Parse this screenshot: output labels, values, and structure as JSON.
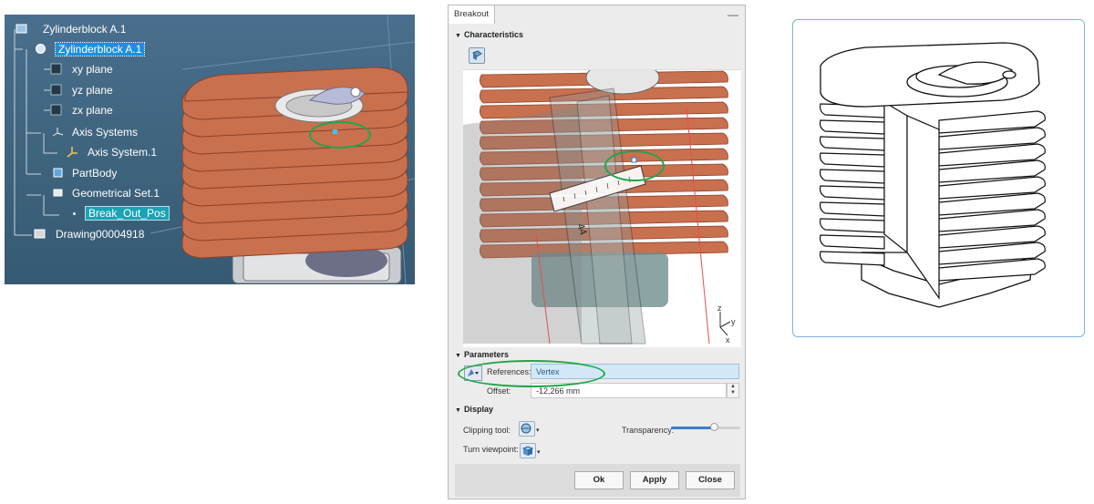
{
  "tree": {
    "root": "Zylinderblock A.1",
    "part": "Zylinderblock A.1",
    "nodes": {
      "xy": "xy plane",
      "yz": "yz plane",
      "zx": "zx plane",
      "axis_systems": "Axis Systems",
      "axis_system_1": "Axis System.1",
      "partbody": "PartBody",
      "geo_set": "Geometrical Set.1",
      "break_out": "Break_Out_Pos",
      "drawing": "Drawing00004918"
    }
  },
  "dialog": {
    "title": "Breakout",
    "minimize": "—",
    "characteristics": "Characteristics",
    "parameters": "Parameters",
    "references_label": "References:",
    "references_value": "Vertex",
    "offset_label": "Offset:",
    "offset_value": "-12,266 mm",
    "display": "Display",
    "clipping_label": "Clipping tool:",
    "transparency_label": "Transparency:",
    "transparency_value": 0.62,
    "viewpoint_label": "Turn viewpoint:",
    "ok": "Ok",
    "apply": "Apply",
    "close": "Close",
    "preview_axis": {
      "z": "z",
      "y": "y",
      "x": "x"
    },
    "ruler_value": "44"
  },
  "colors": {
    "fin": "#c9704f",
    "fin_dark": "#8c4128",
    "highlight": "#1fa64a",
    "accent": "#3b7ec8",
    "tree_bg": "#40657f"
  }
}
